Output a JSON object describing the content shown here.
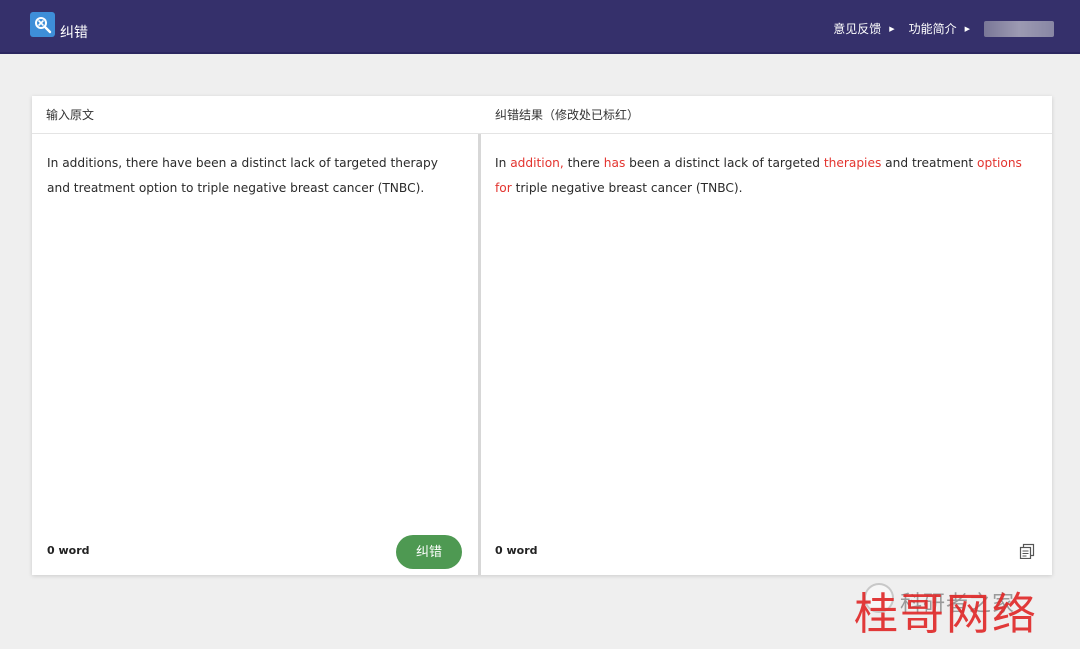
{
  "header": {
    "app_title": "纠错",
    "logo_icon": "search-check-icon",
    "nav": [
      {
        "label": "意见反馈"
      },
      {
        "label": "功能简介"
      }
    ],
    "colors": {
      "background": "#35306b"
    }
  },
  "input_panel": {
    "title": "输入原文",
    "text": "In additions, there have been a distinct lack of targeted therapy and treatment option to triple negative breast cancer (TNBC).",
    "word_count": "0 word",
    "correct_button": "纠错"
  },
  "result_panel": {
    "title": "纠错结果（修改处已标红）",
    "segments": [
      {
        "text": "In ",
        "changed": false
      },
      {
        "text": "addition,",
        "changed": true
      },
      {
        "text": " there ",
        "changed": false
      },
      {
        "text": "has",
        "changed": true
      },
      {
        "text": " been a distinct lack of targeted ",
        "changed": false
      },
      {
        "text": "therapies",
        "changed": true
      },
      {
        "text": " and treatment ",
        "changed": false
      },
      {
        "text": "options for",
        "changed": true
      },
      {
        "text": " triple negative breast cancer (TNBC).",
        "changed": false
      }
    ],
    "word_count": "0 word",
    "copy_icon": "copy-icon",
    "colors": {
      "changed_text": "#e3342f"
    }
  },
  "watermark": {
    "subtitle": "科研者之家",
    "main": "桂哥网络"
  },
  "theme": {
    "button_color": "#4e9952",
    "page_background": "#efefef"
  }
}
